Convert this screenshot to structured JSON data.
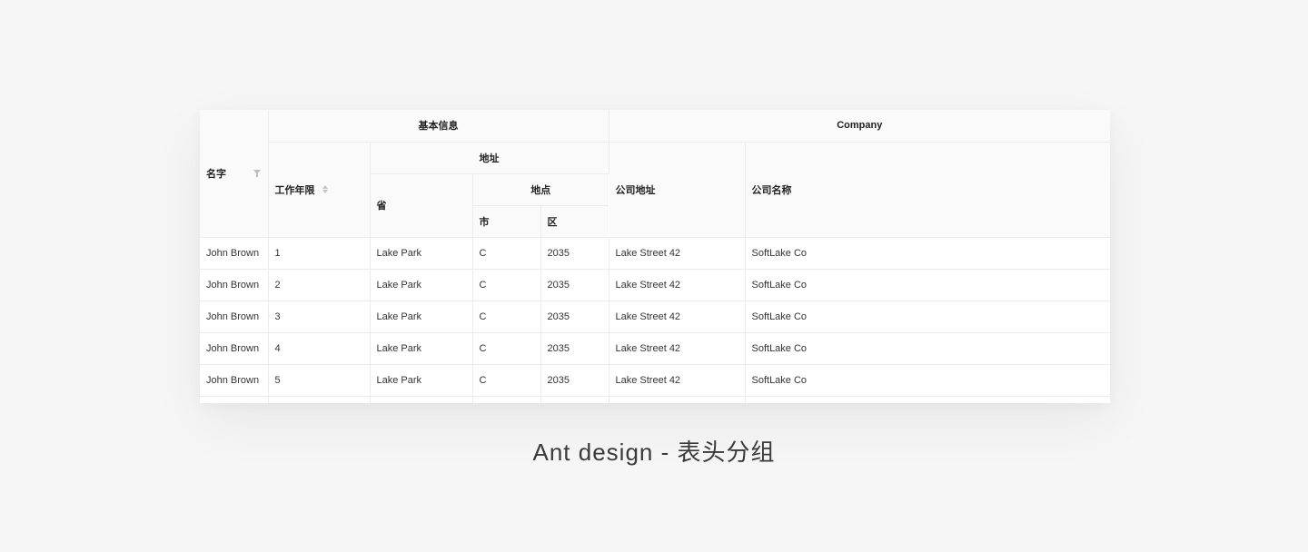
{
  "table": {
    "headers": {
      "name": "名字",
      "basic_info": "基本信息",
      "years": "工作年限",
      "address": "地址",
      "province": "省",
      "location": "地点",
      "city": "市",
      "district": "区",
      "company": "Company",
      "company_address": "公司地址",
      "company_name": "公司名称"
    },
    "rows": [
      {
        "name": "John Brown",
        "years": "1",
        "province": "Lake Park",
        "city": "C",
        "district": "2035",
        "company_address": "Lake Street 42",
        "company_name": "SoftLake Co"
      },
      {
        "name": "John Brown",
        "years": "2",
        "province": "Lake Park",
        "city": "C",
        "district": "2035",
        "company_address": "Lake Street 42",
        "company_name": "SoftLake Co"
      },
      {
        "name": "John Brown",
        "years": "3",
        "province": "Lake Park",
        "city": "C",
        "district": "2035",
        "company_address": "Lake Street 42",
        "company_name": "SoftLake Co"
      },
      {
        "name": "John Brown",
        "years": "4",
        "province": "Lake Park",
        "city": "C",
        "district": "2035",
        "company_address": "Lake Street 42",
        "company_name": "SoftLake Co"
      },
      {
        "name": "John Brown",
        "years": "5",
        "province": "Lake Park",
        "city": "C",
        "district": "2035",
        "company_address": "Lake Street 42",
        "company_name": "SoftLake Co"
      }
    ],
    "icons": {
      "name_filter": "filter-icon",
      "years_sorter": "sorter-icon"
    }
  },
  "caption": "Ant design - 表头分组"
}
